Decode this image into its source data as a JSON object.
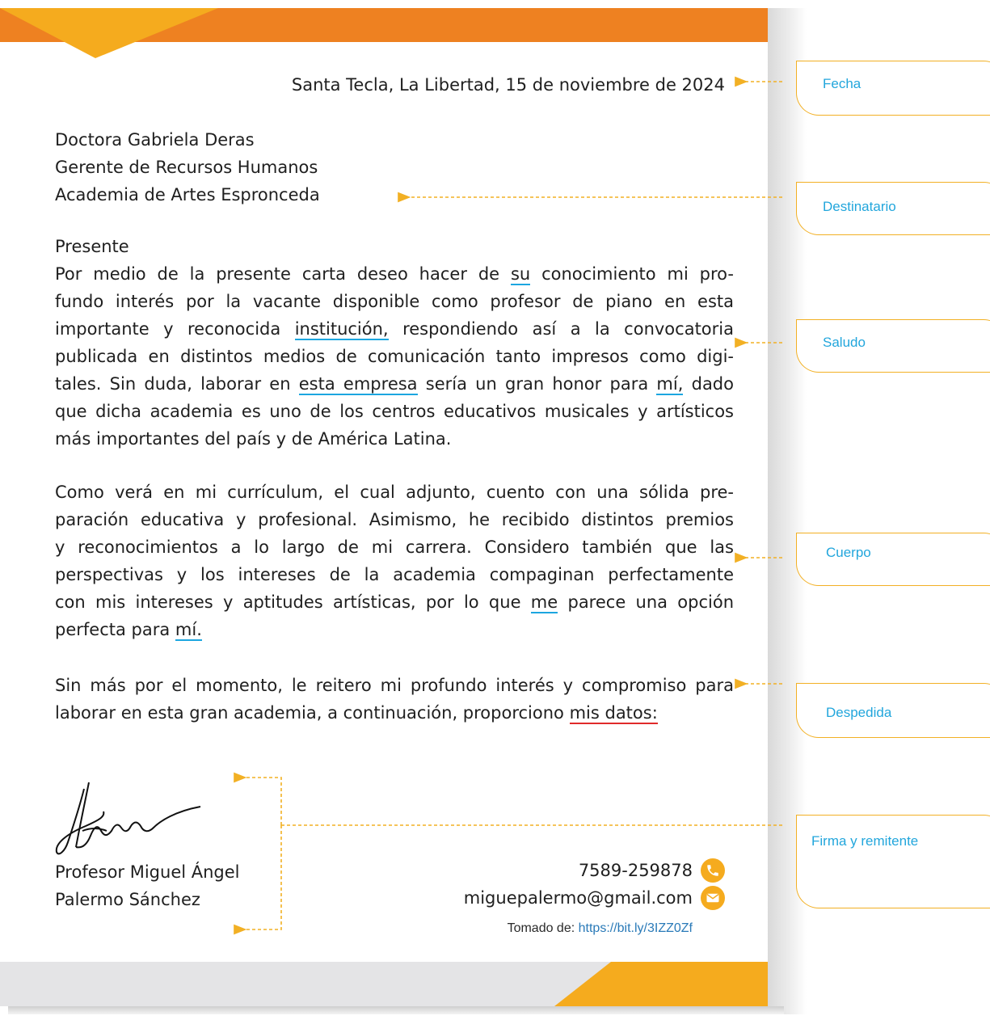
{
  "letter": {
    "date": "Santa Tecla, La Libertad, 15 de noviembre de 2024",
    "recipient": [
      "Doctora Gabriela Deras",
      "Gerente de Recursos Humanos",
      "Academia de Artes Espronceda"
    ],
    "greeting": "Presente",
    "p1": {
      "l1a": "Por medio de la presente carta deseo hacer de",
      "l1u": "su",
      "l1b": "conocimiento mi pro-",
      "l2": "fundo interés por la vacante disponible como profesor de piano en esta",
      "l3a": "importante y reconocida",
      "l3u": "institución,",
      "l3b": "respondiendo así a la convocatoria",
      "l4": "publicada en distintos medios de comunicación tanto impresos como digi-",
      "l5a": "tales. Sin duda, laborar en",
      "l5u1": "esta empresa",
      "l5b": "sería un gran honor para",
      "l5u2": "mí,",
      "l5c": "dado",
      "l6": "que dicha academia es uno de los centros educativos musicales y artísticos",
      "l7": "más importantes del país y de América Latina."
    },
    "p2": {
      "l1": "Como verá en mi currículum, el cual adjunto, cuento con una sólida pre-",
      "l2": "paración educativa y profesional. Asimismo, he recibido distintos premios",
      "l3": "y reconocimientos a lo largo de mi carrera. Considero también que las",
      "l4": "perspectivas y los intereses de la academia compaginan perfectamente",
      "l5a": "con mis intereses y aptitudes artísticas, por lo que",
      "l5u": "me",
      "l5b": "parece una opción",
      "l6a": "perfecta para",
      "l6u": "mí."
    },
    "p3": {
      "l1": "Sin más por el momento, le reitero mi profundo interés y compromiso para",
      "l2a": "laborar en esta gran academia, a continuación, proporciono",
      "l2u": "mis datos:"
    },
    "signer": [
      "Profesor Miguel Ángel",
      "Palermo Sánchez"
    ],
    "phone": "7589-259878",
    "email": "miguepalermo@gmail.com",
    "phone_icon": "phone-icon",
    "email_icon": "envelope-icon",
    "source_label": "Tomado de:",
    "source_link": "https://bit.ly/3IZZ0Zf"
  },
  "tags": {
    "fecha": "Fecha",
    "destinatario": "Destinatario",
    "saludo": "Saludo",
    "cuerpo": "Cuerpo",
    "despedida": "Despedida",
    "firma": "Firma y remitente"
  },
  "colors": {
    "accent_orange": "#ee8121",
    "accent_yellow": "#f5ab1e",
    "tag_text": "#22a6dc",
    "underline_blue": "#1ca6e0",
    "underline_red": "#e02a2a"
  }
}
